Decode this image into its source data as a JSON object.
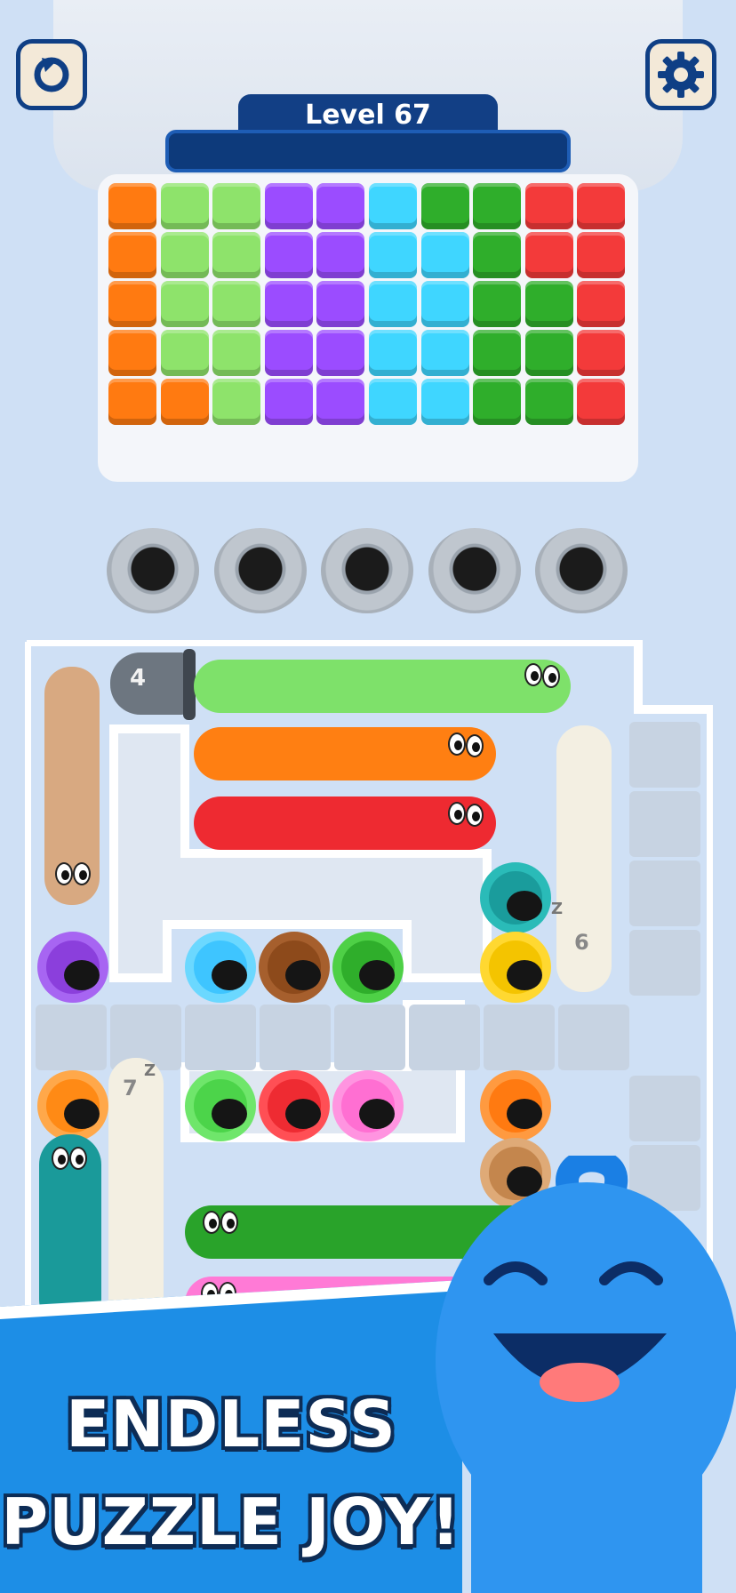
{
  "header": {
    "level_label": "Level 67",
    "restart_icon": "restart-icon",
    "settings_icon": "gear-icon"
  },
  "board": {
    "columns": [
      [
        "#ff7a11",
        "#ff7a11",
        "#ff7a11",
        "#ff7a11",
        "#ff7a11"
      ],
      [
        "#8ee36b",
        "#8ee36b",
        "#8ee36b",
        "#8ee36b",
        "#ff7a11"
      ],
      [
        "#8ee36b",
        "#8ee36b",
        "#8ee36b",
        "#8ee36b",
        "#8ee36b"
      ],
      [
        "#9b4cff",
        "#9b4cff",
        "#9b4cff",
        "#9b4cff",
        "#9b4cff"
      ],
      [
        "#9b4cff",
        "#9b4cff",
        "#9b4cff",
        "#9b4cff",
        "#9b4cff"
      ],
      [
        "#3fd6ff",
        "#3fd6ff",
        "#3fd6ff",
        "#3fd6ff",
        "#3fd6ff"
      ],
      [
        "#2fae2b",
        "#3fd6ff",
        "#3fd6ff",
        "#3fd6ff",
        "#3fd6ff"
      ],
      [
        "#2fae2b",
        "#2fae2b",
        "#2fae2b",
        "#2fae2b",
        "#2fae2b"
      ],
      [
        "#f33a3a",
        "#f33a3a",
        "#2fae2b",
        "#2fae2b",
        "#2fae2b"
      ],
      [
        "#f33a3a",
        "#f33a3a",
        "#f33a3a",
        "#f33a3a",
        "#f33a3a"
      ]
    ]
  },
  "holes": {
    "count": 5
  },
  "maze": {
    "pipe_count": "4",
    "sleeping_worm_a_count": "6",
    "sleeping_worm_b_count": "7",
    "sleep_symbol": "Z"
  },
  "promo": {
    "line1": "ENDLESS",
    "line2": "PUZZLE JOY!"
  }
}
